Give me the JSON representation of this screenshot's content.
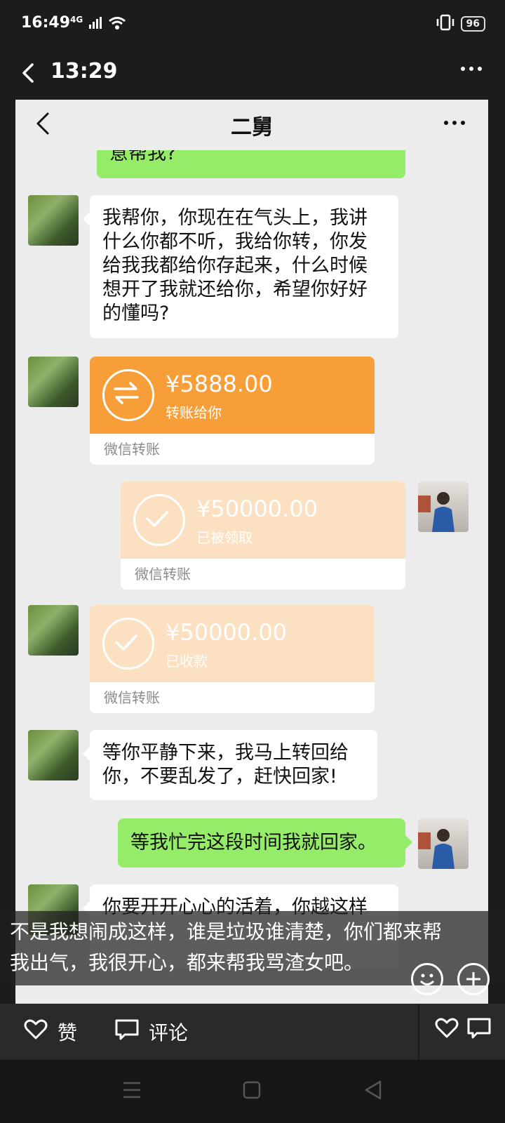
{
  "status_bar": {
    "time": "16:49",
    "network": "4G",
    "battery": "96"
  },
  "header": {
    "title": "13:29"
  },
  "chat": {
    "title": "二舅",
    "messages": [
      {
        "side": "right",
        "type": "text",
        "lines": [
          "意帮我?"
        ]
      },
      {
        "side": "left",
        "type": "text",
        "lines": [
          "我帮你，你现在在气头上，我讲",
          "什么你都不听，我给你转，你发",
          "给我我都给你存起来，什么时候",
          "想开了我就还给你，希望你好好",
          "的懂吗?"
        ]
      },
      {
        "side": "left",
        "type": "transfer",
        "amount": "¥5888.00",
        "status": "转账给你",
        "footer": "微信转账"
      },
      {
        "side": "right",
        "type": "transfer",
        "amount": "¥50000.00",
        "status": "已被领取",
        "footer": "微信转账"
      },
      {
        "side": "left",
        "type": "transfer",
        "amount": "¥50000.00",
        "status": "已收款",
        "footer": "微信转账"
      },
      {
        "side": "left",
        "type": "text",
        "lines": [
          "等你平静下来，我马上转回给",
          "你，不要乱发了，赶快回家!"
        ]
      },
      {
        "side": "right",
        "type": "text",
        "lines": [
          "等我忙完这段时间我就回家。"
        ]
      },
      {
        "side": "left",
        "type": "text",
        "lines": [
          "你要开开心心的活着，你越这样"
        ]
      }
    ]
  },
  "caption": {
    "lines": [
      "不是我想闹成这样，谁是垃圾谁清楚，你们都来帮",
      "我出气，我很开心，都来帮我骂渣女吧。"
    ]
  },
  "actions": {
    "like_label": "赞",
    "comment_label": "评论"
  },
  "colors": {
    "green_bubble": "#95ec69",
    "transfer_orange": "#f79e38",
    "transfer_received": "#fce0c2"
  }
}
